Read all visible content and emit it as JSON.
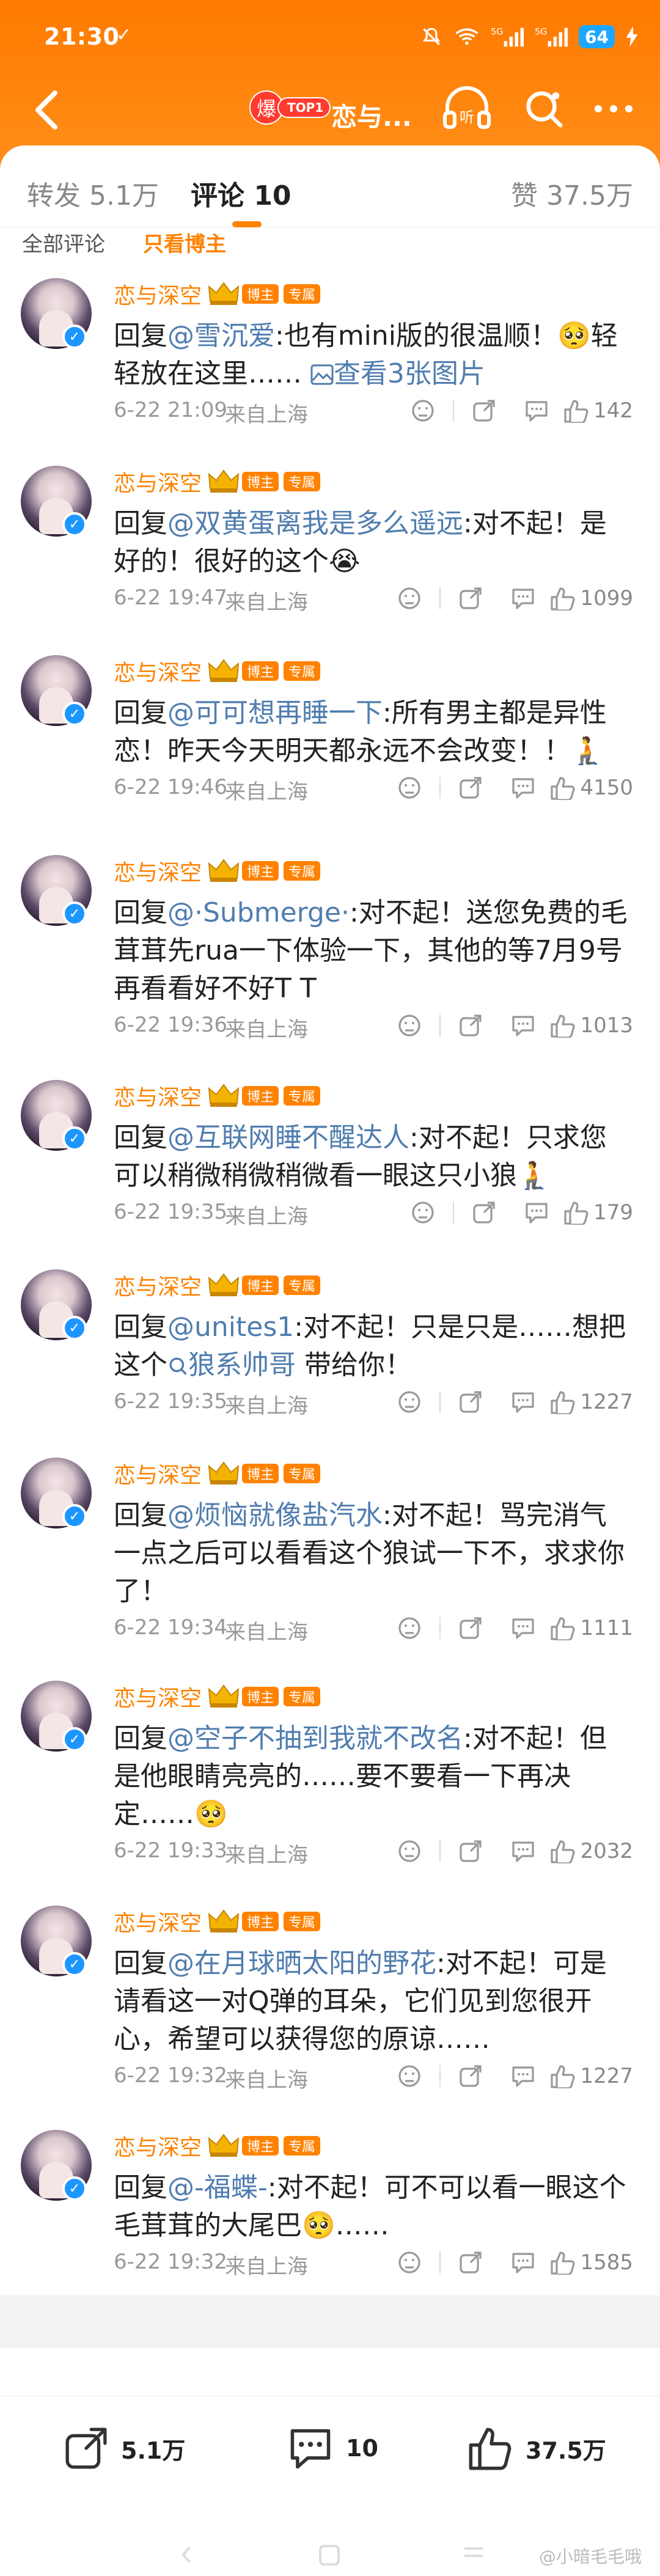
{
  "status_bar": {
    "time": "21:30",
    "check": "✓",
    "battery": "64"
  },
  "header": {
    "hot_icon": "爆",
    "hot_label": "TOP1",
    "title": "恋与...",
    "listen": "听"
  },
  "tabs": {
    "repost": "转发 5.1万",
    "comments": "评论 10",
    "likes": "赞 37.5万"
  },
  "subtabs": {
    "all": "全部评论",
    "host_only": "只看博主"
  },
  "badges": {
    "host": "博主",
    "fan": "专属"
  },
  "comments": [
    {
      "user": "恋与深空",
      "reply_prefix": "回复",
      "mention": "@雪沉爱",
      "body": ":也有mini版的很温顺！🥺轻轻放在这里……",
      "link": "查看3张图片",
      "date": "6-22 21:09",
      "loc": "来自上海",
      "likes": "142"
    },
    {
      "user": "恋与深空",
      "reply_prefix": "回复",
      "mention": "@双黄蛋离我是多么遥远",
      "body": ":对不起！是好的！很好的这个😭",
      "date": "6-22 19:47",
      "loc": "来自上海",
      "likes": "1099"
    },
    {
      "user": "恋与深空",
      "reply_prefix": "回复",
      "mention": "@可可想再睡一下",
      "body": ":所有男主都是异性恋！昨天今天明天都永远不会改变！！🧎",
      "date": "6-22 19:46",
      "loc": "来自上海",
      "likes": "4150"
    },
    {
      "user": "恋与深空",
      "reply_prefix": "回复",
      "mention": "@·Submerge·",
      "body": ":对不起！送您免费的毛茸茸先rua一下体验一下，其他的等7月9号再看看好不好T T",
      "date": "6-22 19:36",
      "loc": "来自上海",
      "likes": "1013"
    },
    {
      "user": "恋与深空",
      "reply_prefix": "回复",
      "mention": "@互联网睡不醒达人",
      "body": ":对不起！只求您可以稍微稍微稍微看一眼这只小狼🧎",
      "date": "6-22 19:35",
      "loc": "来自上海",
      "likes": "179"
    },
    {
      "user": "恋与深空",
      "reply_prefix": "回复",
      "mention": "@unites1",
      "body": ":对不起！只是只是……想把这个",
      "link": "狼系帅哥",
      "body2": " 带给你！",
      "date": "6-22 19:35",
      "loc": "来自上海",
      "likes": "1227"
    },
    {
      "user": "恋与深空",
      "reply_prefix": "回复",
      "mention": "@烦恼就像盐汽水",
      "body": ":对不起！骂完消气一点之后可以看看这个狼试一下不，求求你了！",
      "date": "6-22 19:34",
      "loc": "来自上海",
      "likes": "1111"
    },
    {
      "user": "恋与深空",
      "reply_prefix": "回复",
      "mention": "@空子不抽到我就不改名",
      "body": ":对不起！但是他眼睛亮亮的……要不要看一下再决定……🥺",
      "date": "6-22 19:33",
      "loc": "来自上海",
      "likes": "2032"
    },
    {
      "user": "恋与深空",
      "reply_prefix": "回复",
      "mention": "@在月球晒太阳的野花",
      "body": ":对不起！可是请看这一对Q弹的耳朵，它们见到您很开心，希望可以获得您的原谅……",
      "date": "6-22 19:32",
      "loc": "来自上海",
      "likes": "1227"
    },
    {
      "user": "恋与深空",
      "reply_prefix": "回复",
      "mention": "@-福蝶-",
      "body": ":对不起！可不可以看一眼这个毛茸茸的大尾巴🥺……",
      "date": "6-22 19:32",
      "loc": "来自上海",
      "likes": "1585"
    }
  ],
  "bottom_bar": {
    "reposts": "5.1万",
    "comments": "10",
    "likes": "37.5万"
  },
  "watermark": "@小暗毛毛哦",
  "colors": {
    "header_orange": "#ff7a00",
    "accent": "#ff8200",
    "mention_blue": "#507daf",
    "verified_blue": "#1e96ff"
  }
}
